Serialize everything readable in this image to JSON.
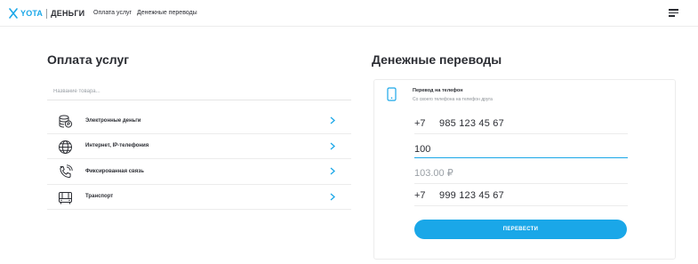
{
  "header": {
    "logo_yota": "YOTA",
    "logo_money": "ДЕНЬГИ",
    "nav": [
      "Оплата услуг",
      "Денежные переводы"
    ]
  },
  "payments": {
    "title": "Оплата услуг",
    "search_placeholder": "Название товара...",
    "categories": [
      {
        "label": "Электронные деньги",
        "icon": "coins-icon"
      },
      {
        "label": "Интернет, IP-телефония",
        "icon": "globe-icon"
      },
      {
        "label": "Фиксированная связь",
        "icon": "phone-handset-icon"
      },
      {
        "label": "Транспорт",
        "icon": "bus-icon"
      }
    ]
  },
  "transfers": {
    "title": "Денежные переводы",
    "card": {
      "title": "Перевод на телефон",
      "subtitle": "Со своего телефона на телефон друга",
      "sender_prefix": "+7",
      "sender_phone": "985 123 45 67",
      "amount": "100",
      "total_with_fee": "103.00 ₽",
      "recipient_prefix": "+7",
      "recipient_phone": "999 123 45 67",
      "submit_label": "ПЕРЕВЕСТИ"
    }
  },
  "colors": {
    "accent": "#1aa7e8",
    "text": "#2b2d33",
    "muted": "#9aa0a6",
    "divider": "#ececec"
  }
}
